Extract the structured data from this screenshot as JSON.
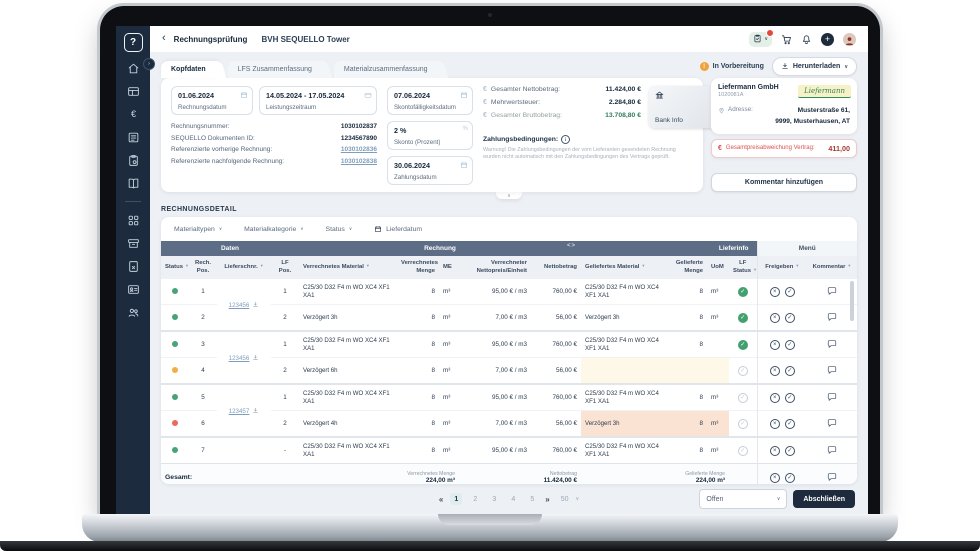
{
  "topbar": {
    "back": "‹",
    "title": "Rechnungsprüfung",
    "project": "BVH SEQUELLO Tower"
  },
  "tabs": [
    {
      "label": "Kopfdaten"
    },
    {
      "label": "LFS Zusammenfassung"
    },
    {
      "label": "Materialzusammenfassung"
    }
  ],
  "status_pill": {
    "label": "In Vorbereitung"
  },
  "download": {
    "label": "Herunterladen"
  },
  "header": {
    "invoice_date": {
      "value": "01.06.2024",
      "label": "Rechnungsdatum"
    },
    "service_period": {
      "value": "14.05.2024 - 17.05.2024",
      "label": "Leistungszeitraum"
    },
    "meta": [
      {
        "label": "Rechnungsnummer:",
        "value": "1030102837",
        "link": false
      },
      {
        "label": "SEQUELLO Dokumenten ID:",
        "value": "1234567890",
        "link": false
      },
      {
        "label": "Referenzierte vorherige Rechnung:",
        "value": "1030102836",
        "link": true
      },
      {
        "label": "Referenzierte nachfolgende Rechnung:",
        "value": "1030102838",
        "link": true
      }
    ],
    "skonto_date": {
      "value": "07.06.2024",
      "label": "Skontofälligkeitsdatum"
    },
    "skonto_pct": {
      "value": "2 %",
      "label": "Skonto (Prozent)"
    },
    "payment_date": {
      "value": "30.06.2024",
      "label": "Zahlungsdatum"
    },
    "totals": [
      {
        "label": "Gesamter Nettobetrag:",
        "value": "11.424,00 €",
        "muted": false
      },
      {
        "label": "Mehrwertsteuer:",
        "value": "2.284,80 €",
        "muted": false
      },
      {
        "label": "Gesamter Bruttobetrag:",
        "value": "13.708,80 €",
        "muted": true
      }
    ],
    "payment_terms_label": "Zahlungsbedingungen:",
    "payment_terms_warning": "Warnung! Die Zahlungsbedingungen der vom Lieferanten gesendeten Rechnung wurden nicht automatisch mit den Zahlungsbedingungen des Vertrags geprüft.",
    "bank_info_label": "Bank Info"
  },
  "supplier": {
    "name": "Liefermann GmbH",
    "id": "1020081A",
    "logo_text": "Liefermann",
    "address_label": "Adresse:",
    "address_line1": "Musterstraße 61,",
    "address_line2": "9999, Musterhausen, AT"
  },
  "deviation": {
    "label": "Gesamtpreisabweichung Vertrag:",
    "value": "411,00"
  },
  "comment_button": "Kommentar hinzufügen",
  "sidebar": {
    "items": [
      "home",
      "table",
      "euro",
      "invoice",
      "clipboard-settings",
      "book",
      "divider",
      "apps",
      "archive",
      "document-remove",
      "id-card",
      "team"
    ],
    "logo_glyph": "?"
  },
  "detail": {
    "title": "RECHNUNGSDETAIL",
    "filters": [
      {
        "label": "Materialtypen"
      },
      {
        "label": "Materialkategorie"
      },
      {
        "label": "Status"
      }
    ],
    "date_filter": "Lieferdatum",
    "groups": {
      "daten": "Daten",
      "rechnung": "Rechnung",
      "lieferinfo": "Lieferinfo",
      "menu": "Menü"
    },
    "columns": [
      {
        "label": "Status",
        "funnel": true,
        "align": "center"
      },
      {
        "label": "Rech. Pos.",
        "funnel": false,
        "align": "center"
      },
      {
        "label": "Lieferschnr.",
        "funnel": true,
        "align": "center"
      },
      {
        "label": "LF Pos.",
        "funnel": false,
        "align": "center"
      },
      {
        "label": "Verrechnetes Material",
        "funnel": true,
        "align": "left"
      },
      {
        "label": "Verrechnetes Menge",
        "funnel": false,
        "align": "right"
      },
      {
        "label": "ME",
        "funnel": false,
        "align": "left"
      },
      {
        "label": "Verrechneter Nettopreis/Einheit",
        "funnel": false,
        "align": "right"
      },
      {
        "label": "Nettobetrag",
        "funnel": false,
        "align": "right"
      },
      {
        "label": "Geliefertes Material",
        "funnel": true,
        "align": "left"
      },
      {
        "label": "Gelieferte Menge",
        "funnel": false,
        "align": "right"
      },
      {
        "label": "UoM",
        "funnel": false,
        "align": "left"
      },
      {
        "label": "LF Status",
        "funnel": true,
        "align": "center"
      },
      {
        "label": "Freigeben",
        "funnel": true,
        "align": "center"
      },
      {
        "label": "Kommentar",
        "funnel": true,
        "align": "center"
      }
    ],
    "delivery_notes": [
      {
        "start": 0,
        "span": 2,
        "number": "123456"
      },
      {
        "start": 2,
        "span": 2,
        "number": "123456"
      },
      {
        "start": 4,
        "span": 2,
        "number": "123457"
      },
      {
        "start": 6,
        "span": 1,
        "number": ""
      }
    ],
    "rows": [
      {
        "status": "green",
        "pos": "1",
        "lfpos": "1",
        "mat": "C25/30 D32 F4 m WO XC4 XF1 XA1",
        "qty": "8",
        "me": "m³",
        "price": "95,00 € / m3",
        "net": "760,00 €",
        "dmat": "C25/30 D32 F4 m WO XC4 XF1 XA1",
        "dqty": "8",
        "duom": "m³",
        "lf": "done",
        "dhigh": ""
      },
      {
        "status": "green",
        "pos": "2",
        "lfpos": "2",
        "mat": "Verzögert 3h",
        "qty": "8",
        "me": "m³",
        "price": "7,00 € / m3",
        "net": "56,00 €",
        "dmat": "Verzögert 3h",
        "dqty": "8",
        "duom": "m³",
        "lf": "done",
        "dhigh": ""
      },
      {
        "status": "green",
        "pos": "3",
        "lfpos": "1",
        "mat": "C25/30 D32 F4 m WO XC4 XF1 XA1",
        "qty": "8",
        "me": "m³",
        "price": "95,00 € / m3",
        "net": "760,00 €",
        "dmat": "C25/30 D32 F4 m WO XC4 XF1 XA1",
        "dqty": "8",
        "duom": "",
        "lf": "done",
        "dhigh": ""
      },
      {
        "status": "yellow",
        "pos": "4",
        "lfpos": "2",
        "mat": "Verzögert 6h",
        "qty": "8",
        "me": "m³",
        "price": "7,00 € / m3",
        "net": "56,00 €",
        "dmat": "",
        "dqty": "",
        "duom": "",
        "lf": "pending",
        "dhigh": "yellow"
      },
      {
        "status": "green",
        "pos": "5",
        "lfpos": "1",
        "mat": "C25/30 D32 F4 m WO XC4 XF1 XA1",
        "qty": "8",
        "me": "m³",
        "price": "95,00 € / m3",
        "net": "760,00 €",
        "dmat": "C25/30 D32 F4 m WO XC4 XF1 XA1",
        "dqty": "8",
        "duom": "m³",
        "lf": "pending",
        "dhigh": ""
      },
      {
        "status": "red",
        "pos": "6",
        "lfpos": "2",
        "mat": "Verzögert 4h",
        "qty": "8",
        "me": "m³",
        "price": "7,00 € / m3",
        "net": "56,00 €",
        "dmat": "Verzögert 3h",
        "dqty": "8",
        "duom": "m³",
        "lf": "pending",
        "dhigh": "red"
      },
      {
        "status": "green",
        "pos": "7",
        "lfpos": "-",
        "mat": "C25/30 D32 F4 m WO XC4 XF1 XA1",
        "qty": "8",
        "me": "m³",
        "price": "95,00 € / m3",
        "net": "760,00 €",
        "dmat": "C25/30 D32 F4 m WO XC4 XF1 XA1",
        "dqty": "8",
        "duom": "m³",
        "lf": "pending",
        "dhigh": ""
      }
    ],
    "footer": {
      "label": "Gesamt:",
      "qty_label": "Verrechnetes Menge",
      "qty_value": "224,00 m³",
      "net_label": "Nettobetrag",
      "net_value": "11.424,00 €",
      "dqty_label": "Gelieferte Menge",
      "dqty_value": "224,00 m³"
    }
  },
  "pagination": {
    "first": "«",
    "pages": [
      "1",
      "2",
      "3",
      "4",
      "5"
    ],
    "last": "»",
    "active": "1",
    "page_size": "50"
  },
  "bottom": {
    "state_select": "Offen",
    "submit": "Abschließen"
  },
  "colors": {
    "sidebar": "#1c2b3d",
    "accent_green": "#43a06f",
    "warn_orange": "#f0a13a",
    "error_red": "#e96a5c",
    "deviation_red": "#d9534f",
    "table_group_header": "#5d6d86"
  }
}
